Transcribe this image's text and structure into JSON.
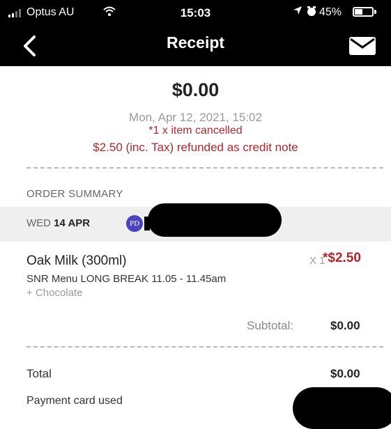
{
  "status_bar": {
    "carrier": "Optus AU",
    "time": "15:03",
    "battery": "45%",
    "battery_level": 0.45
  },
  "nav": {
    "title": "Receipt"
  },
  "receipt": {
    "amount": "$0.00",
    "datetime": "Mon, Apr 12, 2021, 15:02",
    "cancelled_note": "*1 x item cancelled",
    "refund_note": "$2.50 (inc. Tax) refunded as credit note"
  },
  "summary": {
    "label": "ORDER SUMMARY",
    "day_prefix": "WED",
    "day_date": "14 APR",
    "badge": "PD"
  },
  "item": {
    "name": "Oak Milk (300ml)",
    "qty": "X 1",
    "price": "*$2.50",
    "menu": "SNR Menu LONG BREAK 11.05 - 11.45am",
    "modifier": "+ Chocolate"
  },
  "subtotal": {
    "label": "Subtotal:",
    "value": "$0.00"
  },
  "total": {
    "label": "Total",
    "value": "$0.00"
  },
  "payment": {
    "label": "Payment card used"
  },
  "colors": {
    "header_bg": "#000000",
    "alert_red": "#b3262c",
    "badge_purple": "#4a43c2"
  },
  "icons": [
    "signal-icon",
    "wifi-icon",
    "location-icon",
    "alarm-icon",
    "battery-icon",
    "back-chevron-icon",
    "mail-icon"
  ]
}
